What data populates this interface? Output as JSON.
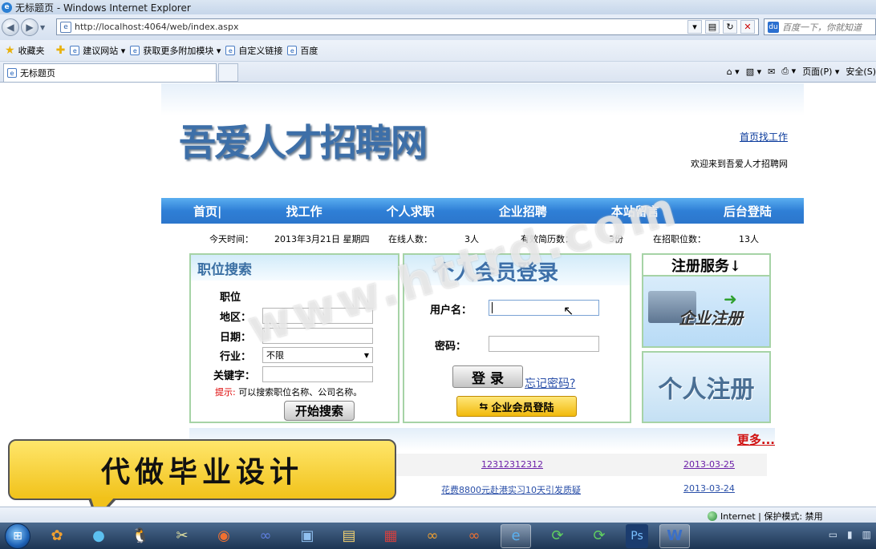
{
  "window": {
    "title": "无标题页 - Windows Internet Explorer"
  },
  "address": {
    "url": "http://localhost:4064/web/index.aspx",
    "search_placeholder": "百度一下，你就知道"
  },
  "favorites": {
    "label": "收藏夹",
    "items": [
      "建议网站 ▾",
      "获取更多附加模块 ▾",
      "自定义链接",
      "百度"
    ]
  },
  "tab": {
    "title": "无标题页"
  },
  "commandbar": {
    "page": "页面(P) ▾",
    "safety": "安全(S)"
  },
  "site": {
    "logo": "吾爱人才招聘网",
    "top_link": "首页找工作",
    "welcome": "欢迎来到吾爱人才招聘网",
    "nav": [
      "首页|",
      "找工作",
      "个人求职",
      "企业招聘",
      "本站留言",
      "后台登陆"
    ],
    "info": {
      "today_label": "今天时间：",
      "today_value": "2013年3月21日 星期四",
      "online_label": "在线人数：",
      "online_value": "3人",
      "resume_label": "有效简历数：",
      "resume_value": "3份",
      "jobs_label": "在招职位数：",
      "jobs_value": "13人"
    },
    "search": {
      "title": "职位搜索",
      "position_label": "职位",
      "area_label": "地区：",
      "date_label": "日期：",
      "industry_label": "行业：",
      "industry_value": "不限",
      "keyword_label": "关键字：",
      "hint_red": "提示:",
      "hint_text": "可以搜索职位名称、公司名称。",
      "button": "开始搜索"
    },
    "login": {
      "title": "个人会员登录",
      "username_label": "用户名：",
      "password_label": "密码：",
      "button": "登 录",
      "forgot": "忘记密码?",
      "corp_button": "企业会员登陆"
    },
    "register": {
      "title": "注册服务↓",
      "corp": "企业注册",
      "personal": "个人注册"
    },
    "news": {
      "more": "更多...",
      "rows": [
        {
          "title": "12312312312",
          "date": "2013-03-25"
        },
        {
          "title": "花费8800元赴港实习10天引发质疑",
          "date": "2013-03-24"
        }
      ]
    }
  },
  "overlay": {
    "watermark": "www.httrd.com",
    "bubble": "代做毕业设计"
  },
  "status": {
    "zone": "Internet | 保护模式: 禁用"
  }
}
